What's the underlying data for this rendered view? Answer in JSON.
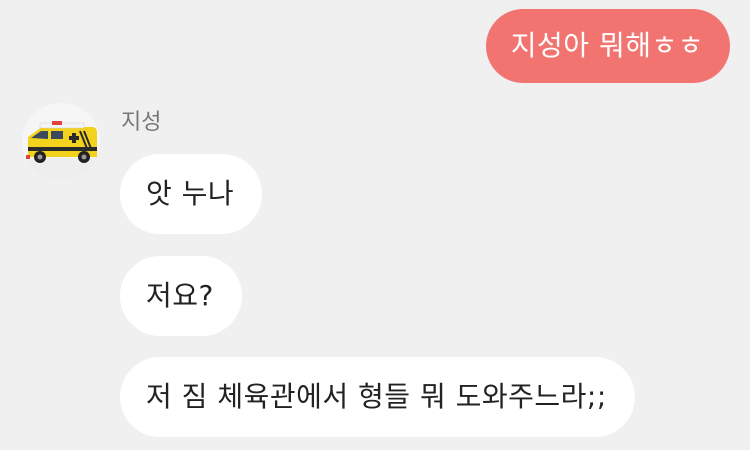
{
  "chat": {
    "sent_messages": [
      {
        "text": "지성아 뭐해ㅎㅎ"
      }
    ],
    "sender": {
      "name": "지성",
      "avatar_icon": "ambulance-toy-icon"
    },
    "received_messages": [
      {
        "text": "앗 누나"
      },
      {
        "text": "저요?"
      },
      {
        "text": "저 짐 체육관에서 형들 뭐 도와주느라;;"
      }
    ]
  },
  "colors": {
    "background": "#f0f0f0",
    "sent_bubble": "#f17471",
    "sent_text": "#ffffff",
    "received_bubble": "#ffffff",
    "received_text": "#222222",
    "sender_name": "#777777"
  }
}
